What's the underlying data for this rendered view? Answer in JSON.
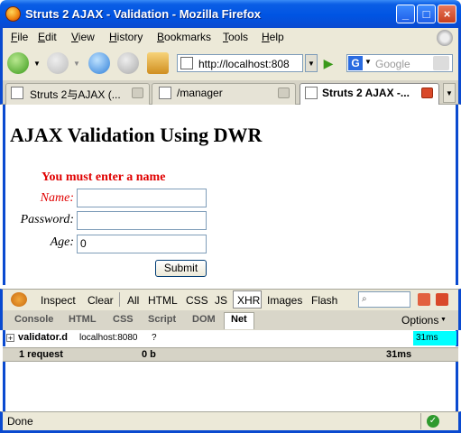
{
  "window": {
    "title": "Struts 2 AJAX - Validation - Mozilla Firefox"
  },
  "menu": [
    "File",
    "Edit",
    "View",
    "History",
    "Bookmarks",
    "Tools",
    "Help"
  ],
  "toolbar": {
    "url": "http://localhost:808",
    "search_placeholder": "Google"
  },
  "tabs": [
    {
      "label": "Struts 2与AJAX (...",
      "active": false
    },
    {
      "label": "/manager",
      "active": false
    },
    {
      "label": "Struts 2 AJAX -...",
      "active": true
    }
  ],
  "page": {
    "heading": "AJAX Validation Using DWR",
    "error": "You must enter a name",
    "form": {
      "name_label": "Name:",
      "password_label": "Password:",
      "age_label": "Age:",
      "age_value": "0",
      "submit_label": "Submit"
    }
  },
  "firebug": {
    "toolbar": [
      "Inspect",
      "Clear",
      "All",
      "HTML",
      "CSS",
      "JS",
      "XHR",
      "Images",
      "Flash"
    ],
    "panels": [
      "Console",
      "HTML",
      "CSS",
      "Script",
      "DOM",
      "Net"
    ],
    "options_label": "Options",
    "request": {
      "file": "validator.d",
      "host": "localhost:8080",
      "size": "?",
      "time": "31ms"
    },
    "summary": {
      "requests": "1 request",
      "size": "0 b",
      "time": "31ms"
    }
  },
  "status": {
    "text": "Done"
  },
  "colors": {
    "error": "#e00000",
    "titlebar": "#0054e3",
    "xhr_bar": "#00ffff"
  }
}
